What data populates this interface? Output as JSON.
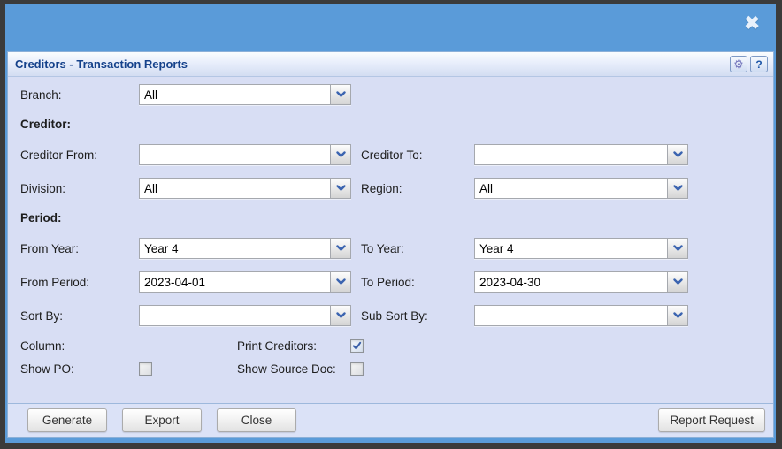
{
  "window": {
    "close_glyph": "✖"
  },
  "dialog": {
    "title": "Creditors - Transaction Reports",
    "gear_glyph": "⚙",
    "help_glyph": "?"
  },
  "fields": {
    "branch": {
      "label": "Branch:",
      "value": "All"
    },
    "creditor_section_label": "Creditor:",
    "creditor_from": {
      "label": "Creditor From:",
      "value": ""
    },
    "creditor_to": {
      "label": "Creditor To:",
      "value": ""
    },
    "division": {
      "label": "Division:",
      "value": "All"
    },
    "region": {
      "label": "Region:",
      "value": "All"
    },
    "period_section_label": "Period:",
    "from_year": {
      "label": "From Year:",
      "value": "Year 4"
    },
    "to_year": {
      "label": "To Year:",
      "value": "Year 4"
    },
    "from_period": {
      "label": "From Period:",
      "value": "2023-04-01"
    },
    "to_period": {
      "label": "To Period:",
      "value": "2023-04-30"
    },
    "sort_by": {
      "label": "Sort By:",
      "value": ""
    },
    "sub_sort_by": {
      "label": "Sub Sort By:",
      "value": ""
    },
    "column": {
      "label": "Column:"
    },
    "print_creditors": {
      "label": "Print Creditors:",
      "checked": true
    },
    "show_po": {
      "label": "Show PO:",
      "checked": false
    },
    "show_source_doc": {
      "label": "Show Source Doc:",
      "checked": false
    }
  },
  "footer": {
    "generate_label": "Generate",
    "export_label": "Export",
    "close_label": "Close",
    "report_request_label": "Report Request"
  },
  "colors": {
    "titlebar_blue": "#5a9bd9",
    "title_text": "#15428b",
    "body_bg": "#d8def4",
    "footer_bg": "#dbe2f7",
    "frame_border": "#3b3b3b",
    "chevron": "#3b64b0",
    "check_mark": "#3a5fa8"
  }
}
